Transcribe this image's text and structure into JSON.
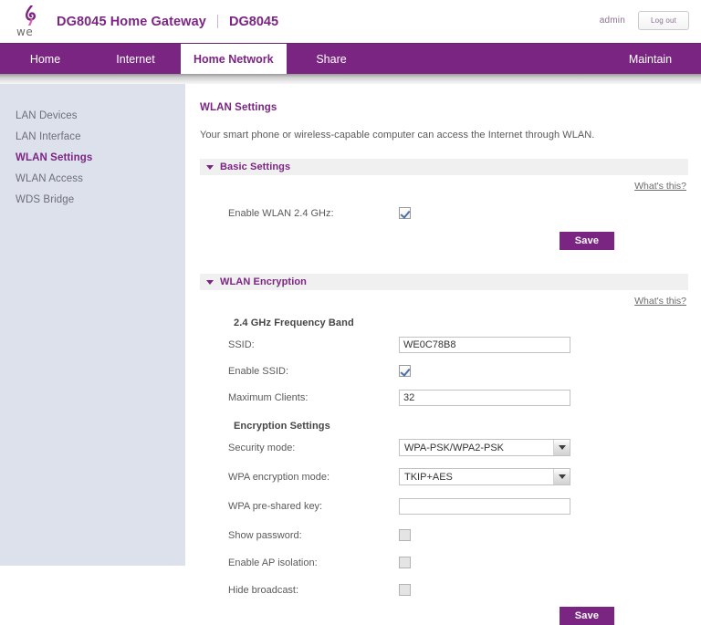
{
  "header": {
    "brand_title": "DG8045 Home Gateway",
    "brand_model": "DG8045",
    "logo_text": "we",
    "user": "admin",
    "logout_label": "Log out"
  },
  "nav": {
    "items": [
      {
        "label": "Home",
        "active": false
      },
      {
        "label": "Internet",
        "active": false
      },
      {
        "label": "Home Network",
        "active": true
      },
      {
        "label": "Share",
        "active": false
      }
    ],
    "right_item": {
      "label": "Maintain",
      "active": false
    }
  },
  "sidebar": {
    "items": [
      {
        "label": "LAN Devices",
        "active": false
      },
      {
        "label": "LAN Interface",
        "active": false
      },
      {
        "label": "WLAN Settings",
        "active": true
      },
      {
        "label": "WLAN Access",
        "active": false
      },
      {
        "label": "WDS Bridge",
        "active": false
      }
    ]
  },
  "main": {
    "page_title": "WLAN Settings",
    "page_description": "Your smart phone or wireless-capable computer can access the Internet through WLAN.",
    "whats_this_label": "What's this?",
    "basic": {
      "section_title": "Basic Settings",
      "enable_wlan_label": "Enable WLAN 2.4 GHz:",
      "enable_wlan_checked": true,
      "save_label": "Save"
    },
    "encryption": {
      "section_title": "WLAN Encryption",
      "band_heading": "2.4 GHz Frequency Band",
      "ssid_label": "SSID:",
      "ssid_value": "WE0C78B8",
      "enable_ssid_label": "Enable SSID:",
      "enable_ssid_checked": true,
      "max_clients_label": "Maximum Clients:",
      "max_clients_value": "32",
      "encryption_settings_heading": "Encryption Settings",
      "security_mode_label": "Security mode:",
      "security_mode_value": "WPA-PSK/WPA2-PSK",
      "wpa_encryption_label": "WPA encryption mode:",
      "wpa_encryption_value": "TKIP+AES",
      "psk_label": "WPA pre-shared key:",
      "psk_value": "",
      "show_password_label": "Show password:",
      "show_password_checked": false,
      "ap_isolation_label": "Enable AP isolation:",
      "ap_isolation_checked": false,
      "hide_broadcast_label": "Hide broadcast:",
      "hide_broadcast_checked": false,
      "save_label": "Save"
    }
  },
  "colors": {
    "brand_purple": "#7b2583",
    "sidebar_bg": "#dce1ec",
    "section_bg": "#f0f0f0"
  }
}
